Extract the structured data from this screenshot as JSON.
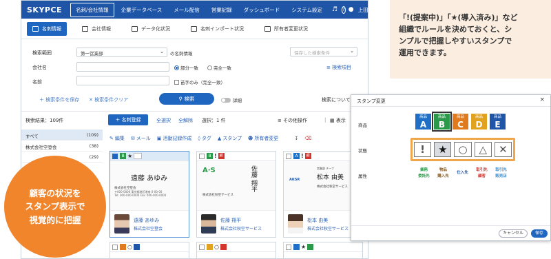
{
  "nav": {
    "logo": "SKYPCE",
    "items": [
      "名刺/会社情報",
      "企業データベース",
      "メール配信",
      "営業記録",
      "ダッシュボード",
      "システム設定"
    ],
    "user": "上田 大樹 ▾"
  },
  "subtabs": [
    "名刺情報",
    "会社情報",
    "データ化状況",
    "名刺インポート状況",
    "所有者変更状況"
  ],
  "form": {
    "scope_label": "検索範囲",
    "scope_value": "第一営業部",
    "scope_suffix": "の名刺情報",
    "saved_search_placeholder": "保存した検索条件",
    "company_label": "会社名",
    "partial_match": "部分一致",
    "exact_match": "完全一致",
    "search_items_link": "検索項目",
    "name_label": "名前",
    "initial_match": "苗字のみ（完全一致）",
    "save_condition": "＋ 検索条件を保存",
    "clear_condition": "✕ 検索条件クリア",
    "search_button": "検索",
    "detail_toggle": "詳細",
    "about_search": "検索について"
  },
  "results": {
    "count": "検索結果：109件",
    "register_button": "＋ 名刺登録",
    "select_all": "全選択",
    "deselect_all": "全解除",
    "selected": "選択：1 件",
    "other_ops": "その他操作",
    "display": "表示"
  },
  "sidebar": [
    {
      "label": "すべて",
      "count": "(109)"
    },
    {
      "label": "株式会社空登会",
      "count": "(38)"
    },
    {
      "label": "",
      "count": "(29)"
    }
  ],
  "actions": [
    "編集",
    "メール",
    "活動記録作成",
    "タグ",
    "スタンプ",
    "所有者変更"
  ],
  "cards": [
    {
      "name_jp": "遠藤 あゆみ",
      "company_jp": "株式会社空登会",
      "foot_name": "遠藤 あゆみ",
      "foot_company": "株式会社空登会",
      "small_line1": "株式会社空登会",
      "small_line2": "〒000-0000 東京都港区港南 0-00-00",
      "small_line3": "Tel: 000-000-0000 Fax: 000-000-0000",
      "product_letter": "B"
    },
    {
      "logo": "A∙S",
      "name_jp": "佐藤 翔平",
      "company_jp": "株式会社秋空サービス",
      "foot_name": "佐藤 翔平",
      "foot_company": "株式会社秋空サービス",
      "product_letter": "B"
    },
    {
      "logo": "AKSR",
      "name_jp": "松本 由美",
      "title_jp": "営業部 チーフ",
      "company_jp": "株式会社秋空サービス",
      "foot_name": "松本 由美",
      "foot_company": "株式会社秋空サービス",
      "product_letter": "A"
    }
  ],
  "overlay_text": [
    "顧客の状況を",
    "スタンプ表示で",
    "視覚的に把握"
  ],
  "callout": [
    "「!(提案中)」「★(導入済み)」など",
    "組織でルールを決めておくと、シ",
    "ンプルで把握しやすいスタンプで",
    "運用できます。"
  ],
  "dialog": {
    "title": "スタンプ変更",
    "label_product": "商品",
    "label_status": "状態",
    "label_attr": "属性",
    "product_prefix": "商品",
    "products": [
      {
        "letter": "A",
        "color": "#1f6fc6"
      },
      {
        "letter": "B",
        "color": "#2a9a4a"
      },
      {
        "letter": "C",
        "color": "#e07a1f"
      },
      {
        "letter": "D",
        "color": "#e0a21f"
      },
      {
        "letter": "E",
        "color": "#1f55a7"
      }
    ],
    "statuses": [
      "!",
      "★",
      "○",
      "△",
      "✕"
    ],
    "attributes": [
      {
        "line1": "業務",
        "line2": "委託先",
        "color": "#2a9a4a"
      },
      {
        "line1": "物品",
        "line2": "購入先",
        "color": "#8a5a1f"
      },
      {
        "line1": "仕入先",
        "line2": "",
        "color": "#1f55a7"
      },
      {
        "line1": "取引先",
        "line2": "顧客",
        "color": "#d2352e"
      },
      {
        "line1": "取引先",
        "line2": "販売店",
        "color": "#3a8fd0"
      }
    ],
    "cancel": "キャンセル",
    "save": "保存"
  }
}
